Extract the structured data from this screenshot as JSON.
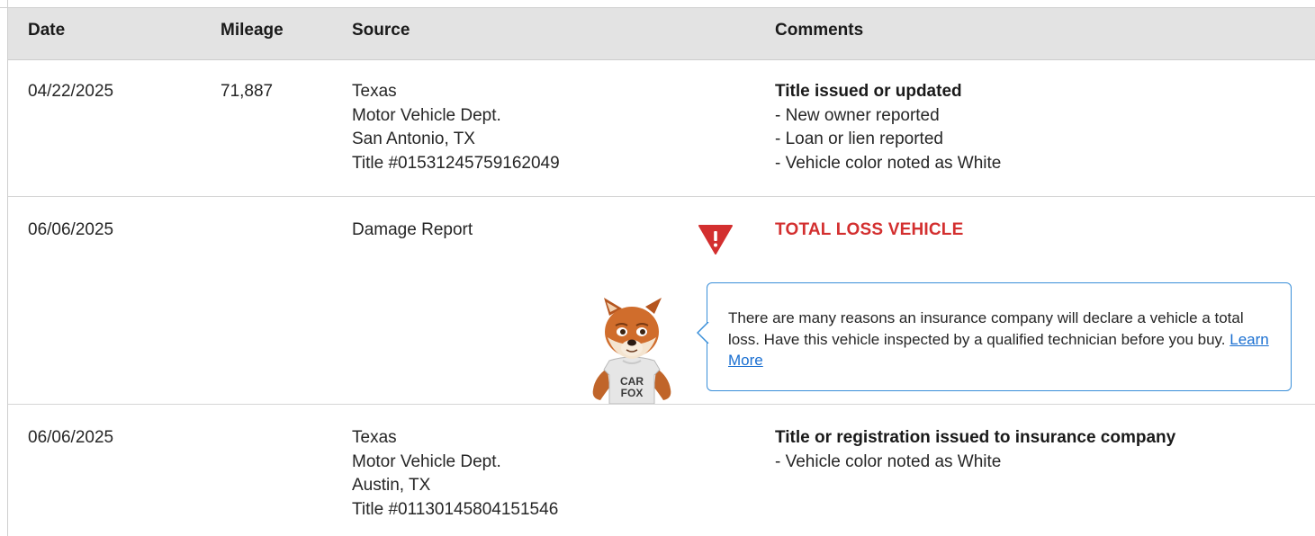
{
  "table": {
    "headers": {
      "date": "Date",
      "mileage": "Mileage",
      "source": "Source",
      "comments": "Comments"
    },
    "rows": [
      {
        "date": "04/22/2025",
        "mileage": "71,887",
        "source": [
          "Texas",
          "Motor Vehicle Dept.",
          "San Antonio, TX",
          "Title #01531245759162049"
        ],
        "comment_title": "Title issued or updated",
        "comment_items": [
          "- New owner reported",
          "- Loan or lien reported",
          "- Vehicle color noted as White"
        ]
      },
      {
        "date": "06/06/2025",
        "mileage": "",
        "source": [
          "Damage Report"
        ],
        "alert_title": "TOTAL LOSS VEHICLE",
        "alert_icon": "warning-triangle-icon",
        "alert_color": "#d32f2f",
        "mascot": "carfox-mascot",
        "mascot_shirt_text": "CAR FOX",
        "tooltip": {
          "text": "There are many reasons an insurance company will declare a vehicle a total loss. Have this vehicle inspected by a qualified technician before you buy.",
          "link_label": "Learn More",
          "border_color": "#3a8fd9"
        }
      },
      {
        "date": "06/06/2025",
        "mileage": "",
        "source": [
          "Texas",
          "Motor Vehicle Dept.",
          "Austin, TX",
          "Title #01130145804151546"
        ],
        "comment_title": "Title or registration issued to insurance company",
        "comment_items": [
          "- Vehicle color noted as White"
        ]
      }
    ]
  }
}
